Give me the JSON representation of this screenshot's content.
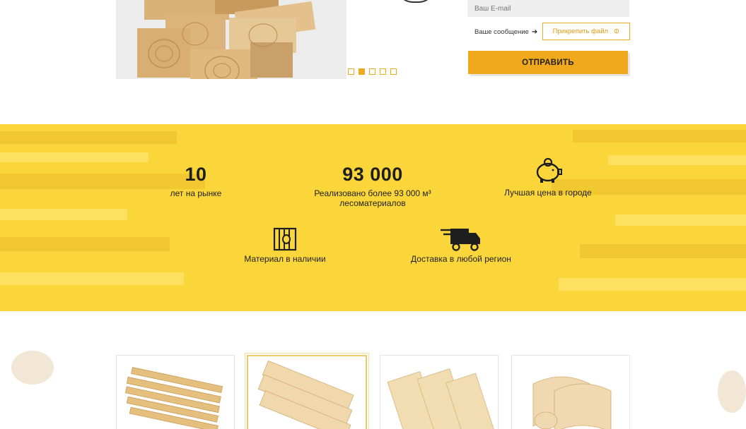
{
  "form": {
    "email_placeholder": "Ваш E-mail",
    "message_label": "Ваше сообщение",
    "attach_label": "Прикрепить файл",
    "submit_label": "ОТПРАВИТЬ"
  },
  "slider": {
    "dot_count": 5,
    "active_index": 1
  },
  "features": {
    "years": {
      "number": "10",
      "label": "лет на рынке"
    },
    "sold": {
      "number": "93 000",
      "label_line1": "Реализовано более 93 000 м³",
      "label_line2": "лесоматериалов"
    },
    "price": {
      "icon": "piggy-bank-icon",
      "label": "Лучшая цена в городе"
    },
    "stock": {
      "icon": "wood-stack-icon",
      "label": "Материал в наличии"
    },
    "delivery": {
      "icon": "delivery-truck-icon",
      "label": "Доставка в любой регион"
    }
  },
  "products": [
    {
      "icon": "lumber-stack-image"
    },
    {
      "icon": "board-planks-image",
      "selected": true
    },
    {
      "icon": "light-boards-image"
    },
    {
      "icon": "log-siding-image"
    }
  ],
  "colors": {
    "accent": "#f0a81c",
    "band": "#fbd63a",
    "text": "#1e1e1e"
  }
}
